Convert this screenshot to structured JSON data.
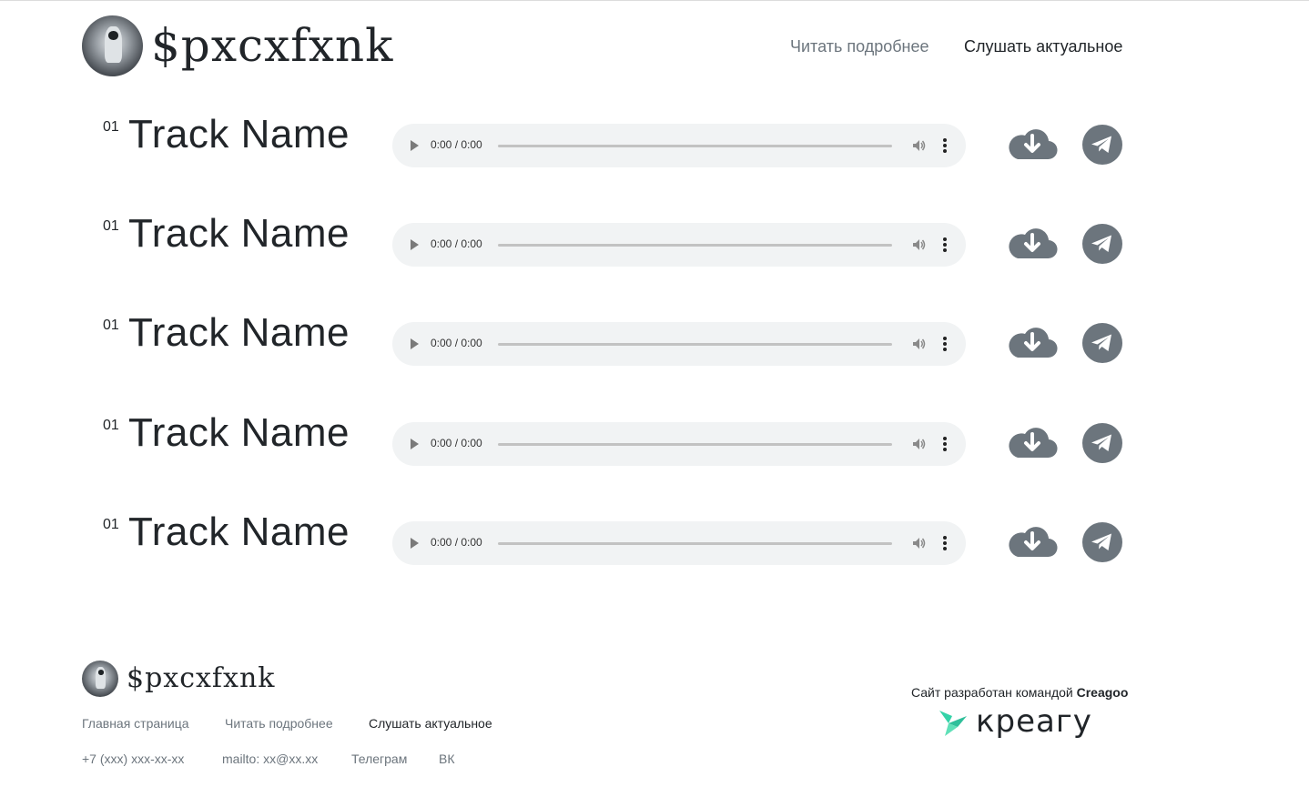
{
  "header": {
    "logo_text": "$pxcxfxnk",
    "nav": [
      {
        "label": "Читать подробнее",
        "color": "#6c757d"
      },
      {
        "label": "Слушать актуальное",
        "color": "#212529"
      }
    ]
  },
  "tracks": [
    {
      "number": "01",
      "name": "Track Name",
      "time": "0:00 / 0:00"
    },
    {
      "number": "01",
      "name": "Track Name",
      "time": "0:00 / 0:00"
    },
    {
      "number": "01",
      "name": "Track Name",
      "time": "0:00 / 0:00"
    },
    {
      "number": "01",
      "name": "Track Name",
      "time": "0:00 / 0:00"
    },
    {
      "number": "01",
      "name": "Track Name",
      "time": "0:00 / 0:00"
    }
  ],
  "footer": {
    "logo_text": "$pxcxfxnk",
    "nav": [
      {
        "label": "Главная страница"
      },
      {
        "label": "Читать подробнее"
      },
      {
        "label": "Слушать актуальное"
      }
    ],
    "contacts": [
      {
        "label": "+7 (xxx) xxx-xx-xx"
      },
      {
        "label": "mailto: xx@xx.xx"
      },
      {
        "label": "Телеграм"
      },
      {
        "label": "ВК"
      }
    ],
    "credit_prefix": "Сайт разработан командой",
    "credit_brand": "Creagoo",
    "brand_logo_text": "креагу"
  },
  "colors": {
    "icon_gray": "#6c757d",
    "player_bg": "#f1f3f4",
    "brand_teal": "#34d3a8"
  }
}
